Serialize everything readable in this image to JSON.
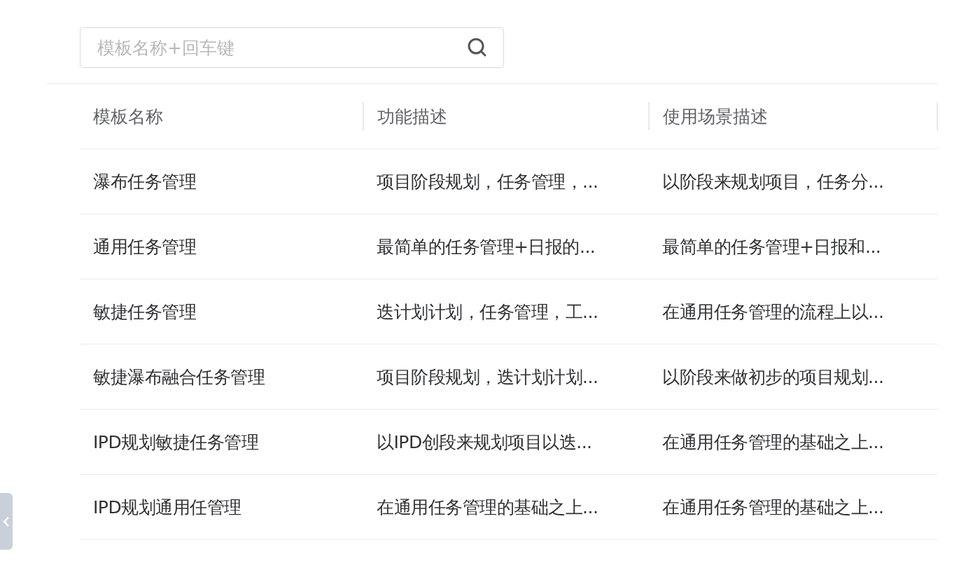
{
  "search": {
    "placeholder": "模板名称+回车键"
  },
  "table": {
    "columns": [
      "模板名称",
      "功能描述",
      "使用场景描述"
    ],
    "rows": [
      {
        "cells": [
          "瀑布任务管理",
          "项目阶段规划，任务管理，...",
          "以阶段来规划项目，任务分..."
        ]
      },
      {
        "cells": [
          "通用任务管理",
          "最简单的任务管理+日报的...",
          "最简单的任务管理+日报和..."
        ]
      },
      {
        "cells": [
          "敏捷任务管理",
          "迭计划计划，任务管理，工...",
          "在通用任务管理的流程上以..."
        ]
      },
      {
        "cells": [
          "敏捷瀑布融合任务管理",
          "项目阶段规划，迭计划计划...",
          "以阶段来做初步的项目规划..."
        ]
      },
      {
        "cells": [
          "IPD规划敏捷任务管理",
          "以IPD创段来规划项目以迭...",
          "在通用任务管理的基础之上..."
        ]
      },
      {
        "cells": [
          "IPD规划通用任管理",
          "在通用任务管理的基础之上...",
          "在通用任务管理的基础之上..."
        ]
      }
    ]
  }
}
